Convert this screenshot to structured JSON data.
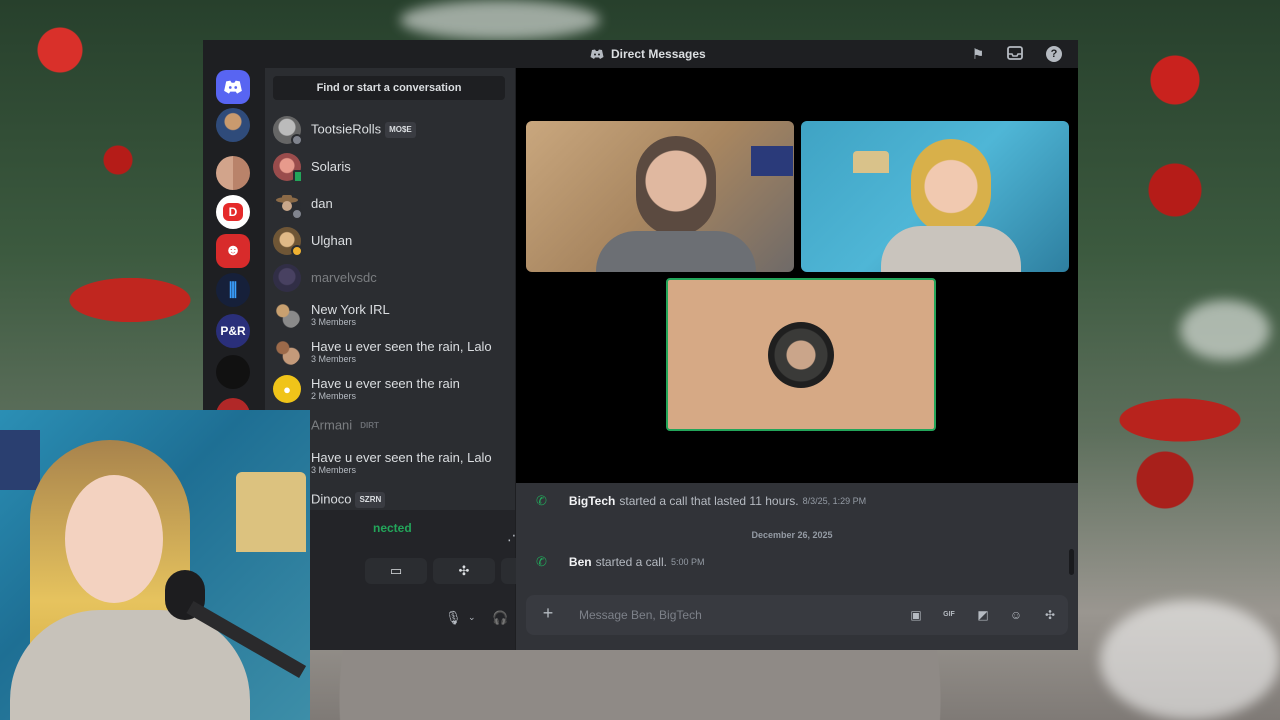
{
  "window": {
    "title": "Direct Messages"
  },
  "dm_sidebar": {
    "search_label": "Find or start a conversation",
    "items": [
      {
        "name": "TootsieRolls",
        "tag": "MO$E",
        "sub": ""
      },
      {
        "name": "Solaris",
        "tag": "",
        "sub": ""
      },
      {
        "name": "dan",
        "tag": "",
        "sub": ""
      },
      {
        "name": "Ulghan",
        "tag": "",
        "sub": ""
      },
      {
        "name": "marvelvsdc",
        "tag": "",
        "sub": ""
      },
      {
        "name": "New York IRL",
        "tag": "",
        "sub": "3 Members"
      },
      {
        "name": "Have u ever seen the rain, Lalo",
        "tag": "",
        "sub": "3 Members"
      },
      {
        "name": "Have u ever seen the rain",
        "tag": "",
        "sub": "2 Members"
      },
      {
        "name": "Armani",
        "tag": "DIRT",
        "sub": ""
      },
      {
        "name": "Have u ever seen the rain, Lalo",
        "tag": "",
        "sub": "3 Members"
      },
      {
        "name": "Dinoco",
        "tag": "SZRN",
        "sub": ""
      }
    ]
  },
  "voice": {
    "status": "nected"
  },
  "chat": {
    "messages": [
      {
        "author": "BigTech",
        "text": "started a call that lasted 11 hours.",
        "time": "8/3/25, 1:29 PM"
      },
      {
        "author": "Ben",
        "text": "started a call.",
        "time": "5:00 PM"
      }
    ],
    "date_divider": "December 26, 2025",
    "composer_placeholder": "Message Ben, BigTech"
  },
  "colors": {
    "accent": "#5865f2",
    "online": "#23a55a",
    "bg": "#1e1f22"
  }
}
